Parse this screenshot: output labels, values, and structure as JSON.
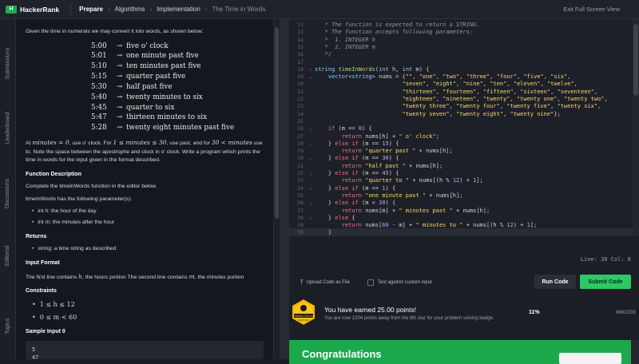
{
  "topbar": {
    "logo_mark": "H",
    "brand": "HackerRank",
    "breadcrumbs": [
      "Prepare",
      "Algorithms",
      "Implementation",
      "The Time in Words"
    ],
    "exit_label": "Exit Full Screen View"
  },
  "side_tabs": [
    "Submissions",
    "Leaderboard",
    "Discussions",
    "Editorial",
    "Topics"
  ],
  "problem": {
    "intro": "Given the time in numerals we may convert it into words, as shown below:",
    "examples": [
      {
        "time": "5:00",
        "words": "five o' clock"
      },
      {
        "time": "5:01",
        "words": "one minute past five"
      },
      {
        "time": "5:10",
        "words": "ten minutes past five"
      },
      {
        "time": "5:15",
        "words": "quarter past five"
      },
      {
        "time": "5:30",
        "words": "half past five"
      },
      {
        "time": "5:40",
        "words": "twenty minutes to six"
      },
      {
        "time": "5:45",
        "words": "quarter to six"
      },
      {
        "time": "5:47",
        "words": "thirteen minutes to six"
      },
      {
        "time": "5:28",
        "words": "twenty eight minutes past five"
      }
    ],
    "arrow": "→",
    "rule_p1": "At ",
    "rule_m0": "minutes = 0",
    "rule_p2": ", use o' clock. For ",
    "rule_m1": "1 ≤ minutes ≤ 30",
    "rule_p3": ", use past, and for ",
    "rule_m2": "30 < minutes",
    "rule_p4": " use to. Note the space between the apostrophe and clock in o' clock. Write a program which prints the time in words for the input given in the format described.",
    "function_desc_title": "Function Description",
    "function_desc": "Complete the timeInWords function in the editor below.",
    "params_intro": "timeInWords has the following parameter(s):",
    "params": [
      "int h: the hour of the day",
      "int m: the minutes after the hour"
    ],
    "returns_title": "Returns",
    "returns": [
      "string: a time string as described"
    ],
    "input_format_title": "Input Format",
    "input_format_p1": "The first line contains ",
    "input_format_h": "h",
    "input_format_p2": ", the hours portion The second line contains ",
    "input_format_m": "m",
    "input_format_p3": ", the minutes portion",
    "constraints_title": "Constraints",
    "constraints": [
      "1 ≤ h ≤ 12",
      "0 ≤ m < 60"
    ],
    "sample_input_title": "Sample Input 0",
    "sample_input": [
      "5",
      "47"
    ]
  },
  "editor": {
    "lines": [
      {
        "n": "12",
        "t": "   * The function is expected to return a STRING."
      },
      {
        "n": "13",
        "t": "   * The function accepts following parameters:"
      },
      {
        "n": "14",
        "t": "   *  1. INTEGER h"
      },
      {
        "n": "15",
        "t": "   *  2. INTEGER m"
      },
      {
        "n": "16",
        "t": "   */"
      },
      {
        "n": "17",
        "t": ""
      },
      {
        "n": "18",
        "t": "string timeInWords(int h, int m) {"
      },
      {
        "n": "19",
        "t": "    vector<string> nums = {\"\", \"one\", \"two\", \"three\", \"four\", \"five\", \"six\","
      },
      {
        "n": "20",
        "t": "                          \"seven\", \"eight\", \"nine\", \"ten\", \"eleven\", \"twelve\","
      },
      {
        "n": "21",
        "t": "                          \"thirteen\", \"fourteen\", \"fifteen\", \"sixteen\", \"seventeen\","
      },
      {
        "n": "22",
        "t": "                          \"eighteen\", \"nineteen\", \"twenty\", \"twenty one\", \"twenty two\","
      },
      {
        "n": "23",
        "t": "                          \"twenty three\", \"twenty four\", \"twenty five\", \"twenty six\","
      },
      {
        "n": "24",
        "t": "                          \"twenty seven\", \"twenty eight\", \"twenty nine\"};"
      },
      {
        "n": "25",
        "t": ""
      },
      {
        "n": "26",
        "t": "    if (m == 0) {"
      },
      {
        "n": "27",
        "t": "        return nums[h] + \" o' clock\";"
      },
      {
        "n": "28",
        "t": "    } else if (m == 15) {"
      },
      {
        "n": "29",
        "t": "        return \"quarter past \" + nums[h];"
      },
      {
        "n": "30",
        "t": "    } else if (m == 30) {"
      },
      {
        "n": "31",
        "t": "        return \"half past \" + nums[h];"
      },
      {
        "n": "32",
        "t": "    } else if (m == 45) {"
      },
      {
        "n": "33",
        "t": "        return \"quarter to \" + nums[(h % 12) + 1];"
      },
      {
        "n": "34",
        "t": "    } else if (m == 1) {"
      },
      {
        "n": "35",
        "t": "        return \"one minute past \" + nums[h];"
      },
      {
        "n": "36",
        "t": "    } else if (m < 30) {"
      },
      {
        "n": "37",
        "t": "        return nums[m] + \" minutes past \" + nums[h];"
      },
      {
        "n": "38",
        "t": "    } else {"
      },
      {
        "n": "39",
        "t": "        return nums[60 - m] + \" minutes to \" + nums[(h % 12) + 1];"
      },
      {
        "n": "39",
        "t": "    }"
      },
      {
        "n": "",
        "t": "}"
      }
    ],
    "cursor_status": "Line: 39 Col: 6"
  },
  "actions": {
    "upload_label": "Upload Code as File",
    "custom_input_label": "Test against custom input",
    "run_label": "Run Code",
    "submit_label": "Submit Code"
  },
  "points": {
    "badge_label": "Problem Solving",
    "badge_stars": "★★★★★",
    "title": "You have earned 25.00 points!",
    "subtitle": "You are now 1204 points away from the 6th star for your problem solving badge.",
    "percent": "11%",
    "progress": "996/2200"
  },
  "congrats": {
    "title": "Congratulations"
  }
}
